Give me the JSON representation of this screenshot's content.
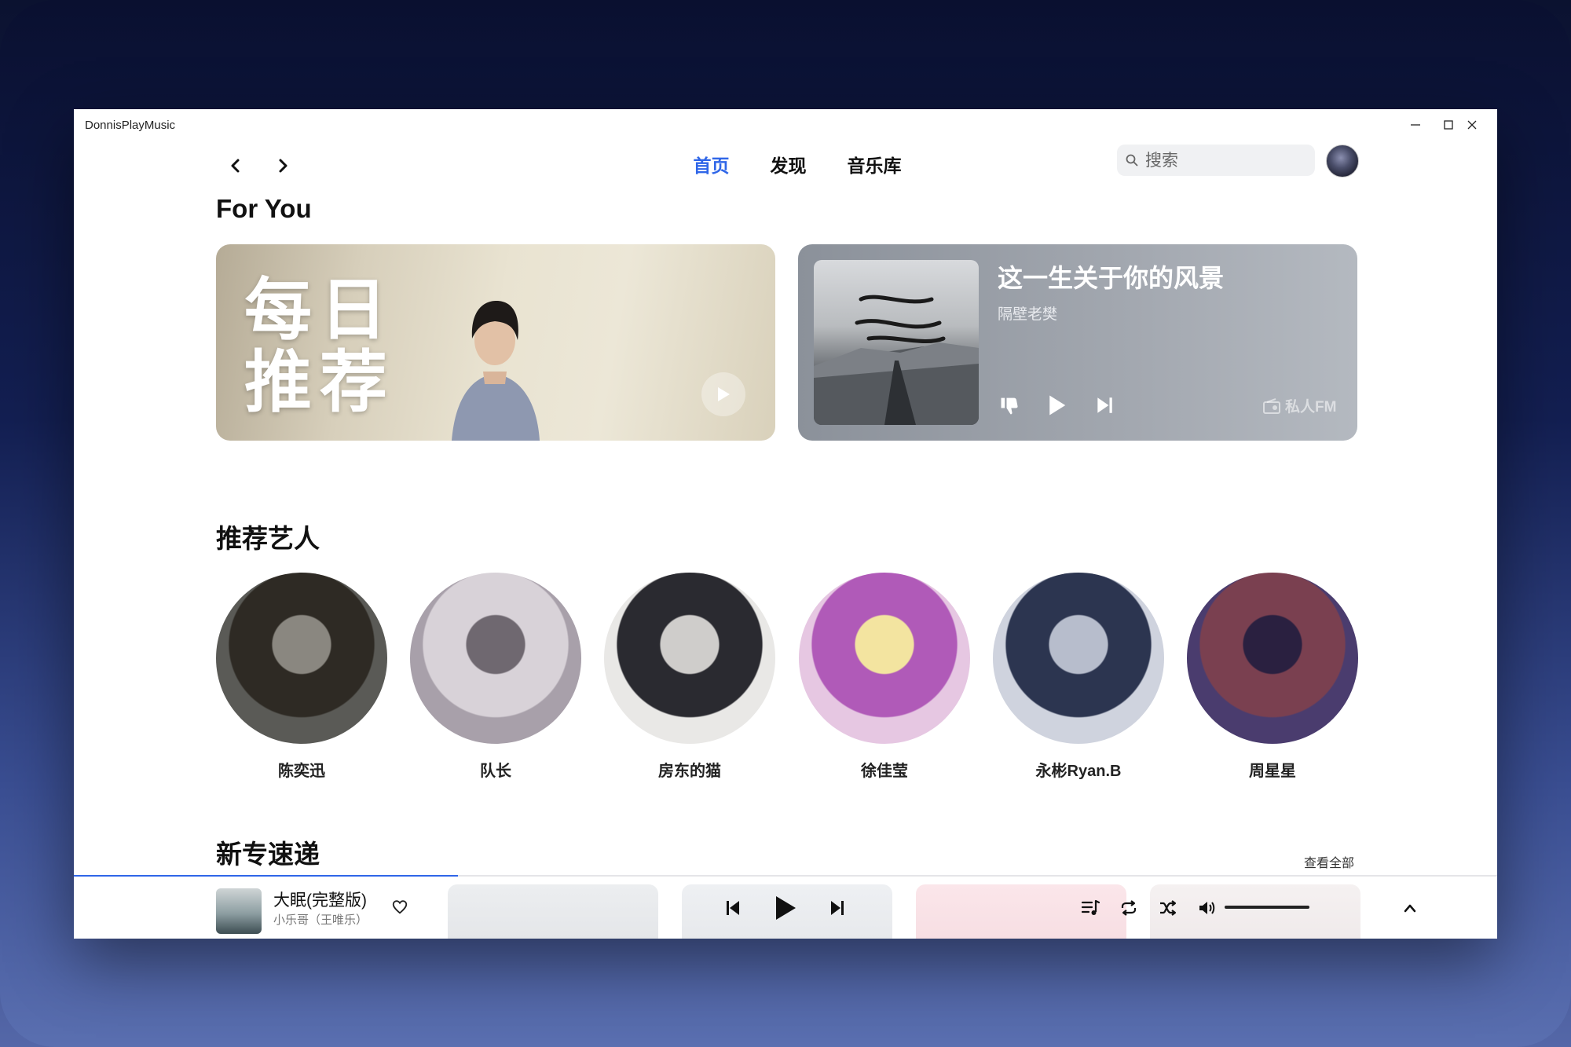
{
  "app": {
    "title": "DonnisPlayMusic"
  },
  "nav": {
    "tabs": [
      {
        "label": "首页",
        "active": true
      },
      {
        "label": "发现",
        "active": false
      },
      {
        "label": "音乐库",
        "active": false
      }
    ]
  },
  "search": {
    "placeholder": "搜索",
    "value": ""
  },
  "for_you": {
    "title": "For You",
    "daily": {
      "title": "每日\n推荐"
    },
    "fm": {
      "song": "这一生关于你的风景",
      "artist": "隔壁老樊",
      "label": "私人FM"
    }
  },
  "artists_section": {
    "title": "推荐艺人",
    "artists": [
      {
        "name": "陈奕迅",
        "colors": [
          "#5a5a56",
          "#8a8780",
          "#2e2a24"
        ]
      },
      {
        "name": "队长",
        "colors": [
          "#a8a0aa",
          "#6f6870",
          "#d8d2d8"
        ]
      },
      {
        "name": "房东的猫",
        "colors": [
          "#e9e8e6",
          "#cfcdcb",
          "#2a2a30"
        ]
      },
      {
        "name": "徐佳莹",
        "colors": [
          "#e6c7e2",
          "#f3e4a0",
          "#b05ab8"
        ]
      },
      {
        "name": "永彬Ryan.B",
        "colors": [
          "#cfd3de",
          "#b7bdcc",
          "#2c3550"
        ]
      },
      {
        "name": "周星星",
        "colors": [
          "#4a3c6e",
          "#2a2040",
          "#7a4050"
        ]
      }
    ]
  },
  "new_albums": {
    "title": "新专速递",
    "see_all": "查看全部"
  },
  "player": {
    "song": "大眠(完整版)",
    "artist": "小乐哥（王唯乐）",
    "progress": 0.27,
    "volume": 1.0
  },
  "colors": {
    "accent": "#2f66e8"
  },
  "icons": [
    "back-icon",
    "forward-icon",
    "search-icon",
    "minimize-icon",
    "maximize-icon",
    "close-icon",
    "play-icon",
    "dislike-icon",
    "next-icon",
    "previous-icon",
    "heart-icon",
    "playlist-icon",
    "repeat-icon",
    "shuffle-icon",
    "volume-icon",
    "chevron-up-icon",
    "radio-icon"
  ]
}
